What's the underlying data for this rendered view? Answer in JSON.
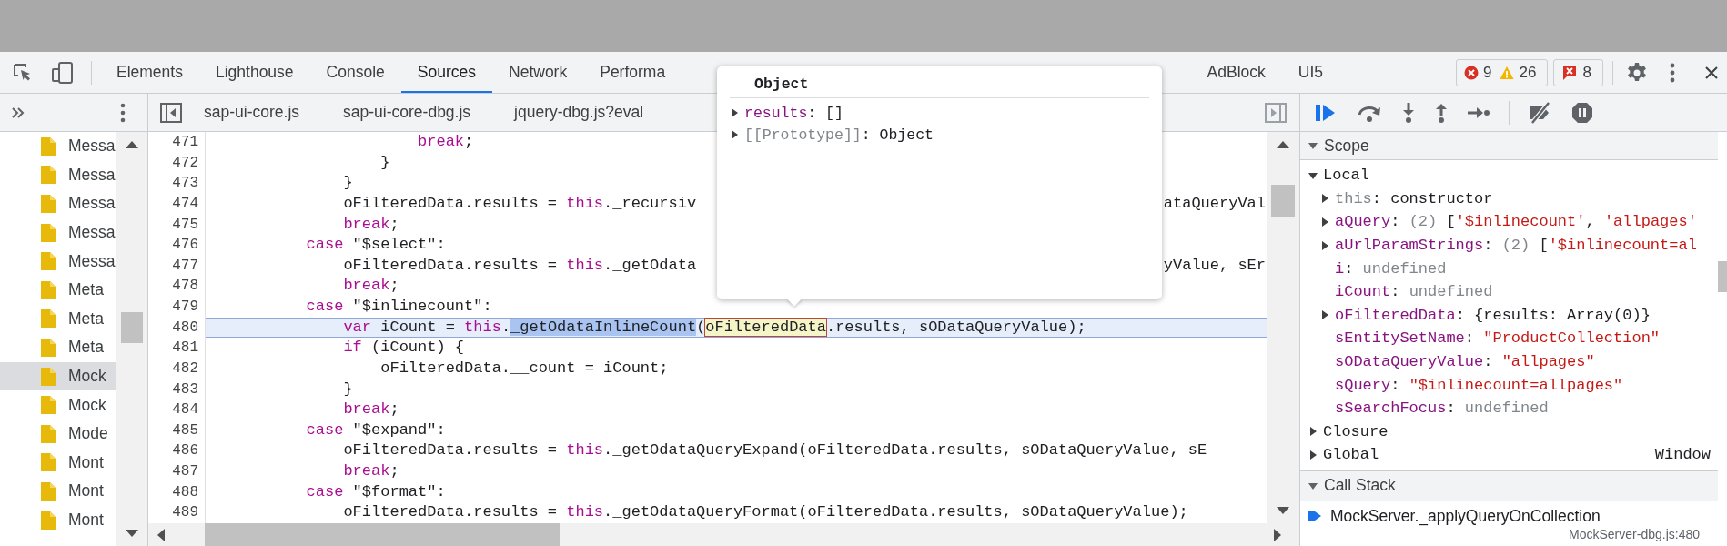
{
  "tabs": [
    {
      "label": "Elements",
      "selected": false
    },
    {
      "label": "Lighthouse",
      "selected": false
    },
    {
      "label": "Console",
      "selected": false
    },
    {
      "label": "Sources",
      "selected": true
    },
    {
      "label": "Network",
      "selected": false
    },
    {
      "label": "Performa",
      "selected": false
    }
  ],
  "extension_tabs": [
    {
      "label": "AdBlock",
      "selected": false
    },
    {
      "label": "UI5",
      "selected": false
    }
  ],
  "console_counts": {
    "errors": "9",
    "warnings": "26",
    "issues": "8"
  },
  "navigator": {
    "files": [
      {
        "name": "Messa",
        "selected": false
      },
      {
        "name": "Messa",
        "selected": false
      },
      {
        "name": "Messa",
        "selected": false
      },
      {
        "name": "Messa",
        "selected": false
      },
      {
        "name": "Messa",
        "selected": false
      },
      {
        "name": "Meta",
        "selected": false
      },
      {
        "name": "Meta",
        "selected": false
      },
      {
        "name": "Meta",
        "selected": false
      },
      {
        "name": "Mock",
        "selected": true
      },
      {
        "name": "Mock",
        "selected": false
      },
      {
        "name": "Mode",
        "selected": false
      },
      {
        "name": "Mont",
        "selected": false
      },
      {
        "name": "Mont",
        "selected": false
      },
      {
        "name": "Mont",
        "selected": false
      }
    ]
  },
  "editor": {
    "file_tabs": [
      "sap-ui-core.js",
      "sap-ui-core-dbg.js",
      "jquery-dbg.js?eval"
    ],
    "lines": [
      {
        "number": "471",
        "current": false,
        "parts": [
          {
            "text": "                    break",
            "kind": "keyword"
          },
          {
            "text": ";",
            "kind": "plain"
          }
        ]
      },
      {
        "number": "472",
        "current": false,
        "parts": [
          {
            "text": "                }",
            "kind": "plain"
          }
        ]
      },
      {
        "number": "473",
        "current": false,
        "parts": [
          {
            "text": "            }",
            "kind": "plain"
          }
        ]
      },
      {
        "number": "474",
        "current": false,
        "parts": [
          {
            "text": "            oFilteredData.results = ",
            "kind": "plain"
          },
          {
            "text": "this",
            "kind": "keyword"
          },
          {
            "text": "._recursiv",
            "kind": "plain"
          }
        ],
        "right": "ataQueryVal"
      },
      {
        "number": "475",
        "current": false,
        "parts": [
          {
            "text": "            break",
            "kind": "keyword"
          },
          {
            "text": ";",
            "kind": "plain"
          }
        ]
      },
      {
        "number": "476",
        "current": false,
        "parts": [
          {
            "text": "        case",
            "kind": "keyword"
          },
          {
            "text": " \"$select\":",
            "kind": "plain"
          }
        ]
      },
      {
        "number": "477",
        "current": false,
        "parts": [
          {
            "text": "            oFilteredData.results = ",
            "kind": "plain"
          },
          {
            "text": "this",
            "kind": "keyword"
          },
          {
            "text": "._getOdata",
            "kind": "plain"
          }
        ],
        "right": "yValue, sEr"
      },
      {
        "number": "478",
        "current": false,
        "parts": [
          {
            "text": "            break",
            "kind": "keyword"
          },
          {
            "text": ";",
            "kind": "plain"
          }
        ]
      },
      {
        "number": "479",
        "current": false,
        "parts": [
          {
            "text": "        case",
            "kind": "keyword"
          },
          {
            "text": " \"$inlinecount\":",
            "kind": "plain"
          }
        ]
      },
      {
        "number": "480",
        "current": true,
        "parts": [
          {
            "text": "            var",
            "kind": "keyword"
          },
          {
            "text": " iCount = ",
            "kind": "plain"
          },
          {
            "text": "this",
            "kind": "keyword"
          },
          {
            "text": ".",
            "kind": "plain"
          },
          {
            "text": "_getOdataInlineCount",
            "kind": "selection"
          },
          {
            "text": "(",
            "kind": "plain"
          },
          {
            "text": "oFilteredData",
            "kind": "hover"
          },
          {
            "text": ".results, sODataQueryValue);",
            "kind": "plain"
          }
        ]
      },
      {
        "number": "481",
        "current": false,
        "parts": [
          {
            "text": "            if",
            "kind": "keyword"
          },
          {
            "text": " (iCount) {",
            "kind": "plain"
          }
        ]
      },
      {
        "number": "482",
        "current": false,
        "parts": [
          {
            "text": "                oFilteredData.__count = iCount;",
            "kind": "plain"
          }
        ]
      },
      {
        "number": "483",
        "current": false,
        "parts": [
          {
            "text": "            }",
            "kind": "plain"
          }
        ]
      },
      {
        "number": "484",
        "current": false,
        "parts": [
          {
            "text": "            break",
            "kind": "keyword"
          },
          {
            "text": ";",
            "kind": "plain"
          }
        ]
      },
      {
        "number": "485",
        "current": false,
        "parts": [
          {
            "text": "        case",
            "kind": "keyword"
          },
          {
            "text": " \"$expand\":",
            "kind": "plain"
          }
        ]
      },
      {
        "number": "486",
        "current": false,
        "parts": [
          {
            "text": "            oFilteredData.results = ",
            "kind": "plain"
          },
          {
            "text": "this",
            "kind": "keyword"
          },
          {
            "text": "._getOdataQueryExpand(oFilteredData.results, sODataQueryValue, sE",
            "kind": "plain"
          }
        ]
      },
      {
        "number": "487",
        "current": false,
        "parts": [
          {
            "text": "            break",
            "kind": "keyword"
          },
          {
            "text": ";",
            "kind": "plain"
          }
        ]
      },
      {
        "number": "488",
        "current": false,
        "parts": [
          {
            "text": "        case",
            "kind": "keyword"
          },
          {
            "text": " \"$format\":",
            "kind": "plain"
          }
        ]
      },
      {
        "number": "489",
        "current": false,
        "parts": [
          {
            "text": "            oFilteredData.results = ",
            "kind": "plain"
          },
          {
            "text": "this",
            "kind": "keyword"
          },
          {
            "text": "._getOdataQueryFormat(oFilteredData.results, sODataQueryValue);",
            "kind": "plain"
          }
        ]
      }
    ]
  },
  "popover": {
    "title": "Object",
    "properties": [
      {
        "expanded": false,
        "parts": [
          {
            "text": "results",
            "kind": "key"
          },
          {
            "text": ": []",
            "kind": "plain"
          }
        ]
      },
      {
        "expanded": false,
        "parts": [
          {
            "text": "[[Prototype]]",
            "kind": "dim"
          },
          {
            "text": ": Object",
            "kind": "plain"
          }
        ]
      }
    ]
  },
  "scope": {
    "title": "Scope",
    "expanded": true,
    "groups": [
      {
        "label": "Local",
        "expanded": true,
        "children": [
          {
            "expandable": true,
            "parts": [
              {
                "text": "this",
                "kind": "dim"
              },
              {
                "text": ": constructor",
                "kind": "plain"
              }
            ]
          },
          {
            "expandable": true,
            "parts": [
              {
                "text": "aQuery",
                "kind": "key"
              },
              {
                "text": ": ",
                "kind": "plain"
              },
              {
                "text": "(2) ",
                "kind": "dim"
              },
              {
                "text": "[",
                "kind": "plain"
              },
              {
                "text": "'$inlinecount'",
                "kind": "string"
              },
              {
                "text": ", ",
                "kind": "plain"
              },
              {
                "text": "'allpages'",
                "kind": "string"
              }
            ]
          },
          {
            "expandable": true,
            "parts": [
              {
                "text": "aUrlParamStrings",
                "kind": "key"
              },
              {
                "text": ": ",
                "kind": "plain"
              },
              {
                "text": "(2) ",
                "kind": "dim"
              },
              {
                "text": "[",
                "kind": "plain"
              },
              {
                "text": "'$inlinecount=al",
                "kind": "string"
              }
            ]
          },
          {
            "expandable": false,
            "parts": [
              {
                "text": "i",
                "kind": "key"
              },
              {
                "text": ": ",
                "kind": "plain"
              },
              {
                "text": "undefined",
                "kind": "dim"
              }
            ]
          },
          {
            "expandable": false,
            "parts": [
              {
                "text": "iCount",
                "kind": "key"
              },
              {
                "text": ": ",
                "kind": "plain"
              },
              {
                "text": "undefined",
                "kind": "dim"
              }
            ]
          },
          {
            "expandable": true,
            "parts": [
              {
                "text": "oFilteredData",
                "kind": "key"
              },
              {
                "text": ": {results: Array(0)}",
                "kind": "plain"
              }
            ]
          },
          {
            "expandable": false,
            "parts": [
              {
                "text": "sEntitySetName",
                "kind": "key"
              },
              {
                "text": ": ",
                "kind": "plain"
              },
              {
                "text": "\"ProductCollection\"",
                "kind": "string"
              }
            ]
          },
          {
            "expandable": false,
            "parts": [
              {
                "text": "sODataQueryValue",
                "kind": "key"
              },
              {
                "text": ": ",
                "kind": "plain"
              },
              {
                "text": "\"allpages\"",
                "kind": "string"
              }
            ]
          },
          {
            "expandable": false,
            "parts": [
              {
                "text": "sQuery",
                "kind": "key"
              },
              {
                "text": ": ",
                "kind": "plain"
              },
              {
                "text": "\"$inlinecount=allpages\"",
                "kind": "string"
              }
            ]
          },
          {
            "expandable": false,
            "parts": [
              {
                "text": "sSearchFocus",
                "kind": "key"
              },
              {
                "text": ": ",
                "kind": "plain"
              },
              {
                "text": "undefined",
                "kind": "dim"
              }
            ]
          }
        ]
      },
      {
        "label": "Closure",
        "expanded": false
      },
      {
        "label": "Global",
        "expanded": false,
        "value": "Window"
      }
    ]
  },
  "call_stack": {
    "title": "Call Stack",
    "expanded": true,
    "frames": [
      {
        "function": "MockServer._applyQueryOnCollection",
        "location": "MockServer-dbg.js:480",
        "current": true
      }
    ]
  }
}
